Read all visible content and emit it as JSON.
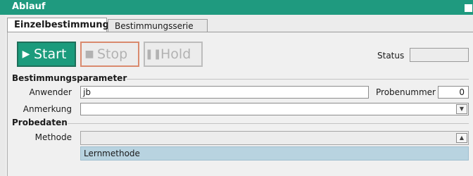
{
  "window": {
    "title": "Ablauf"
  },
  "tabs": [
    {
      "label": "Einzelbestimmung",
      "active": true
    },
    {
      "label": "Bestimmungsserie",
      "active": false
    }
  ],
  "toolbar": {
    "start_label": "Start",
    "stop_label": "Stop",
    "hold_label": "Hold",
    "start_icon": "play-icon",
    "stop_icon": "stop-square-icon",
    "hold_icon": "pause-icon",
    "status_label": "Status",
    "status_value": ""
  },
  "bestimmungsparameter": {
    "section_title": "Bestimmungsparameter",
    "anwender_label": "Anwender",
    "anwender_value": "jb",
    "probennummer_label": "Probenummer",
    "probennummer_value": "0",
    "anmerkung_label": "Anmerkung",
    "anmerkung_value": ""
  },
  "probedaten": {
    "section_title": "Probedaten",
    "methode_label": "Methode",
    "methode_value": "",
    "methode_options": [
      "Lernmethode"
    ]
  },
  "colors": {
    "accent": "#1f9a7f",
    "start_button": "#1b9b7c",
    "stop_border": "#d98a6e",
    "option_highlight": "#b8d3e0"
  }
}
